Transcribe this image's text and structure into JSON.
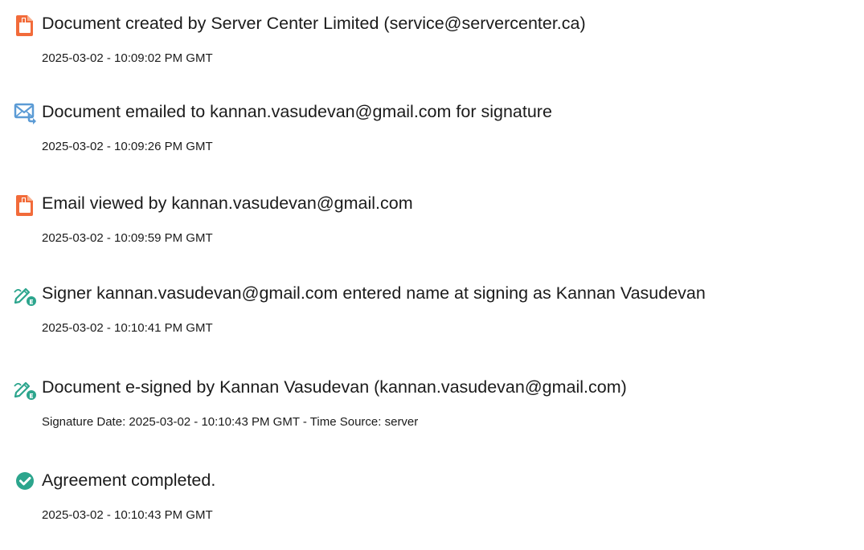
{
  "events": [
    {
      "icon": "document-icon",
      "color": "#f26b3a",
      "description": "Document created by Server Center Limited (service@servercenter.ca)",
      "timestamp": "2025-03-02 - 10:09:02 PM GMT"
    },
    {
      "icon": "email-send-icon",
      "color": "#5b9bd5",
      "description": "Document emailed to kannan.vasudevan@gmail.com for signature",
      "timestamp": "2025-03-02 - 10:09:26 PM GMT"
    },
    {
      "icon": "document-icon",
      "color": "#f26b3a",
      "description": "Email viewed by kannan.vasudevan@gmail.com",
      "timestamp": "2025-03-02 - 10:09:59 PM GMT"
    },
    {
      "icon": "signature-pen-icon",
      "color": "#2ca58d",
      "description": "Signer kannan.vasudevan@gmail.com entered name at signing as Kannan Vasudevan",
      "timestamp": "2025-03-02 - 10:10:41 PM GMT"
    },
    {
      "icon": "signature-pen-icon",
      "color": "#2ca58d",
      "description": "Document e-signed by Kannan Vasudevan (kannan.vasudevan@gmail.com)",
      "timestamp": "Signature Date: 2025-03-02 - 10:10:43 PM GMT - Time Source: server"
    },
    {
      "icon": "check-circle-icon",
      "color": "#2ca58d",
      "description": "Agreement completed.",
      "timestamp": "2025-03-02 - 10:10:43 PM GMT"
    }
  ]
}
